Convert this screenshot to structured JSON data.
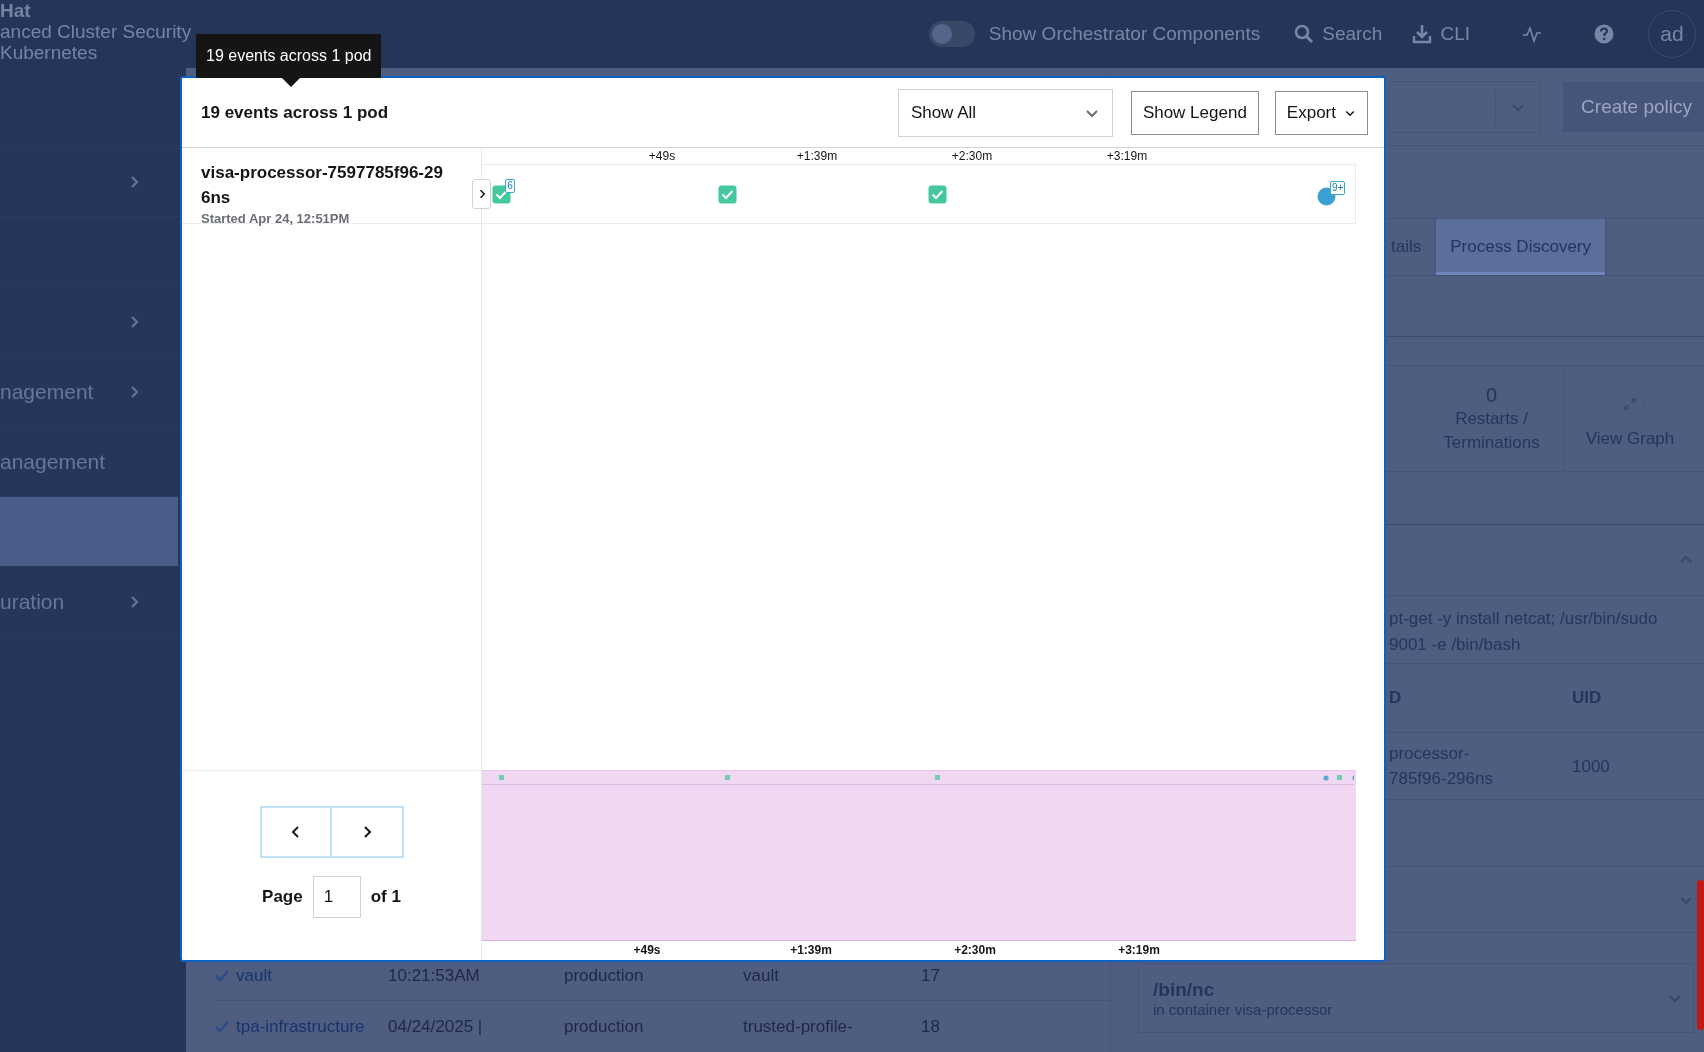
{
  "masthead": {
    "brand_lines": [
      "Hat",
      "anced Cluster Security",
      "Kubernetes"
    ],
    "orchestrator_toggle": {
      "label": "Show Orchestrator Components",
      "on": false
    },
    "search": {
      "label": "Search"
    },
    "cli": {
      "label": "CLI"
    },
    "avatar": {
      "initials": "ad"
    }
  },
  "sidebar": {
    "items": [
      {
        "expandable": false,
        "selected": false
      },
      {
        "expandable": true,
        "selected": false
      },
      {
        "expandable": false,
        "selected": false
      },
      {
        "expandable": true,
        "selected": false
      },
      {
        "label": "nagement",
        "expandable": true,
        "selected": false
      },
      {
        "label": "anagement",
        "expandable": false,
        "selected": false
      },
      {
        "expandable": false,
        "selected": true
      },
      {
        "label": "uration",
        "expandable": true,
        "selected": false
      }
    ]
  },
  "deployments_table": {
    "rows": [
      {
        "name": "vault",
        "column_2": [
          "10:21:53AM"
        ],
        "column_3": "production",
        "column_4": [
          "vault"
        ],
        "column_5": "17"
      },
      {
        "name": "tpa-infrastructure",
        "column_2": [
          "04/24/2025 |"
        ],
        "column_3": "production",
        "column_4": [
          "trusted-profile-"
        ],
        "column_5": "18"
      }
    ]
  },
  "side_panel": {
    "create_policy_button": "Create policy",
    "tabs": [
      {
        "label": "tails",
        "selected": false
      },
      {
        "label": "Process Discovery",
        "selected": true
      }
    ],
    "stats": [
      {
        "value": "0",
        "label": "Restarts / Terminations"
      }
    ],
    "view_graph": "View Graph",
    "process_section": {
      "expanded": true,
      "command_lines": [
        "pt-get -y install netcat; /usr/bin/sudo",
        "9001 -e /bin/bash"
      ],
      "columns": [
        "D",
        "UID"
      ],
      "rows": [
        {
          "cells": [
            [
              "processor-",
              "785f96-296ns"
            ],
            [
              "1000"
            ]
          ]
        }
      ]
    },
    "collapsed_section": {
      "expanded": false
    },
    "process_card": {
      "title": "/bin/nc",
      "subtitle": "in container visa-processor",
      "expanded": false
    }
  },
  "event_modal": {
    "tooltip": "19 events across 1 pod",
    "title": "19 events across 1 pod",
    "filter_select": {
      "value": "Show All"
    },
    "buttons": [
      {
        "label": "Show Legend",
        "kind": "plain"
      },
      {
        "label": "Export",
        "kind": "dropdown"
      }
    ],
    "axis_labels": [
      "+49s",
      "+1:39m",
      "+2:30m",
      "+3:19m"
    ],
    "pods": [
      {
        "name": "visa-processor-7597785f96-296ns",
        "started": "Started Apr 24, 12:51PM",
        "events": [
          {
            "kind": "process",
            "badge": "6"
          },
          {
            "kind": "process"
          },
          {
            "kind": "process"
          },
          {
            "kind": "group",
            "badge": "9+"
          }
        ]
      }
    ],
    "minimap_axis_labels": [
      "+49s",
      "+1:39m",
      "+2:30m",
      "+3:19m"
    ],
    "pagination": {
      "label": "Page",
      "page": "1",
      "of": "of 1"
    }
  }
}
